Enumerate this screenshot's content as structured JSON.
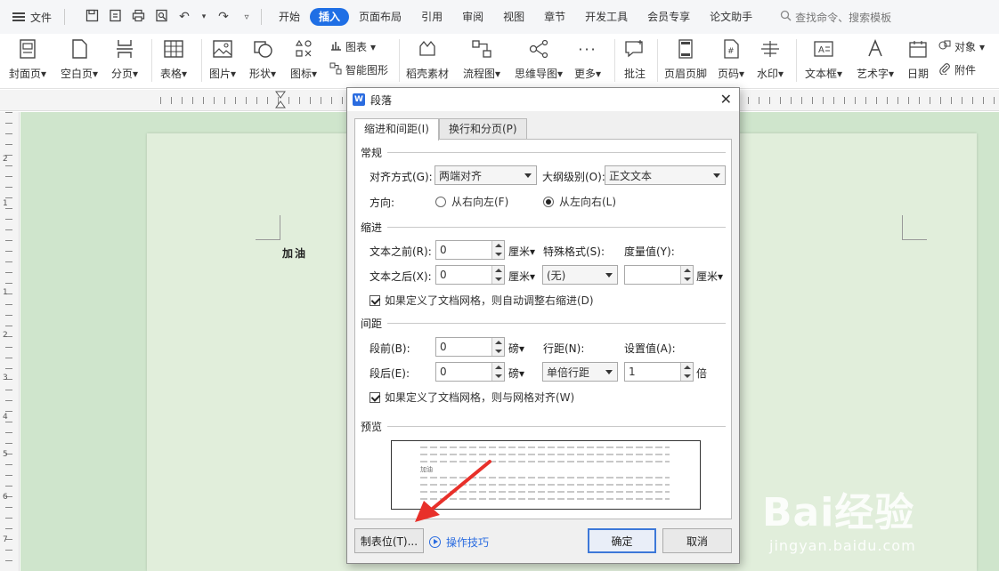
{
  "menubar": {
    "file": "文件",
    "tabs": [
      "开始",
      "插入",
      "页面布局",
      "引用",
      "审阅",
      "视图",
      "章节",
      "开发工具",
      "会员专享",
      "论文助手"
    ],
    "active_tab": "插入",
    "search": "查找命令、搜索模板"
  },
  "ribbon": {
    "cover": "封面页",
    "blank": "空白页",
    "pagebreak": "分页",
    "table": "表格",
    "picture": "图片",
    "shape": "形状",
    "icon": "图标",
    "chart": "图表",
    "smartart": "智能图形",
    "material": "稻壳素材",
    "flowchart": "流程图",
    "mindmap": "思维导图",
    "more": "更多",
    "comment": "批注",
    "header_footer": "页眉页脚",
    "page_num": "页码",
    "watermark": "水印",
    "textbox": "文本框",
    "wordart": "艺术字",
    "date": "日期",
    "object": "对象",
    "attachment": "附件"
  },
  "ruler": {
    "v_numbers": [
      "2",
      "1",
      "1",
      "2",
      "3",
      "4",
      "5",
      "6",
      "7"
    ]
  },
  "document": {
    "text": "加油"
  },
  "dialog": {
    "title": "段落",
    "tabs": [
      "缩进和间距(I)",
      "换行和分页(P)"
    ],
    "general": {
      "title": "常规",
      "align_label": "对齐方式(G):",
      "align_value": "两端对齐",
      "outline_label": "大纲级别(O):",
      "outline_value": "正文文本",
      "direction_label": "方向:",
      "rtl": "从右向左(F)",
      "ltr": "从左向右(L)"
    },
    "indent": {
      "title": "缩进",
      "before_label": "文本之前(R):",
      "before_value": "0",
      "after_label": "文本之后(X):",
      "after_value": "0",
      "unit": "厘米",
      "special_label": "特殊格式(S):",
      "special_value": "(无)",
      "measure_label": "度量值(Y):",
      "measure_value": "",
      "auto_adjust": "如果定义了文档网格，则自动调整右缩进(D)"
    },
    "spacing": {
      "title": "间距",
      "before_label": "段前(B):",
      "before_value": "0",
      "after_label": "段后(E):",
      "after_value": "0",
      "unit": "磅",
      "line_label": "行距(N):",
      "line_value": "单倍行距",
      "setting_label": "设置值(A):",
      "setting_value": "1",
      "setting_unit": "倍",
      "snap_grid": "如果定义了文档网格，则与网格对齐(W)"
    },
    "preview": {
      "title": "预览",
      "sample": "加油"
    },
    "buttons": {
      "tabs": "制表位(T)...",
      "tips": "操作技巧",
      "ok": "确定",
      "cancel": "取消"
    }
  },
  "watermark": {
    "brand": "Bai经验",
    "url": "jingyan.baidu.com"
  },
  "colors": {
    "accent": "#1f6fe5",
    "doc_bg": "#cfe5cc",
    "arrow": "#e8302a"
  }
}
